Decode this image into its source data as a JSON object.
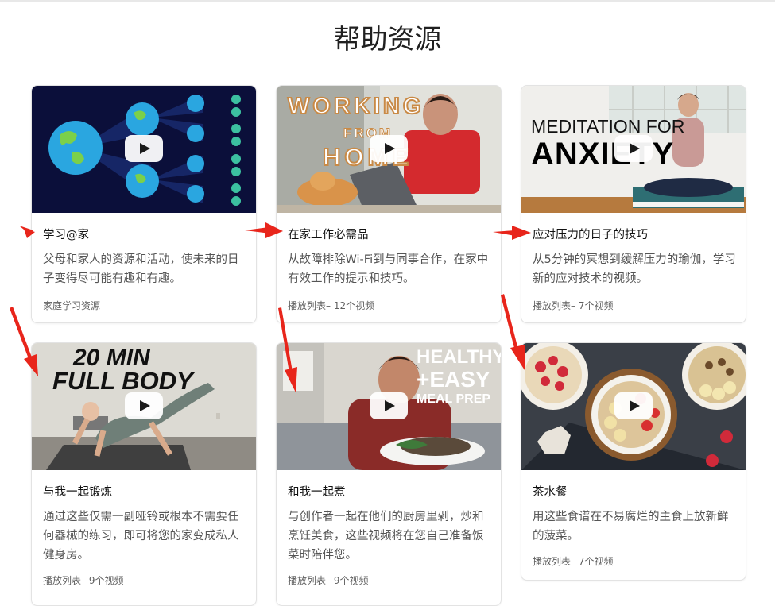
{
  "page": {
    "title": "帮助资源"
  },
  "cards": [
    {
      "title": "学习@家",
      "description": "父母和家人的资源和活动，使未来的日子变得尽可能有趣和有趣。",
      "meta": "家庭学习资源",
      "thumb_icon": "globe-network-thumbnail"
    },
    {
      "title": "在家工作必需品",
      "description": "从故障排除Wi-Fi到与同事合作，在家中有效工作的提示和技巧。",
      "meta": "播放列表– 12个视频",
      "thumb_icon": "working-from-home-thumbnail",
      "overlay": {
        "line1": "WORKING",
        "line2": "FROM",
        "line3": "HOME"
      }
    },
    {
      "title": "应对压力的日子的技巧",
      "description": "从5分钟的冥想到缓解压力的瑜伽，学习新的应对技术的视频。",
      "meta": "播放列表– 7个视频",
      "thumb_icon": "meditation-thumbnail",
      "overlay": {
        "line1": "MEDITATION FOR",
        "line2": "ANXIETY"
      }
    },
    {
      "title": "与我一起锻炼",
      "description": "通过这些仅需一副哑铃或根本不需要任何器械的练习，即可将您的家变成私人健身房。",
      "meta": "播放列表– 9个视频",
      "thumb_icon": "workout-thumbnail",
      "overlay": {
        "line1": "20 MIN",
        "line2": "FULL BODY"
      }
    },
    {
      "title": "和我一起煮",
      "description": "与创作者一起在他们的厨房里剁，炒和烹饪美食，这些视频将在您自己准备饭菜时陪伴您。",
      "meta": "播放列表– 9个视频",
      "thumb_icon": "cooking-thumbnail",
      "overlay": {
        "line1": "HEALTHY",
        "line2": "+EASY",
        "line3": "MEAL PREP"
      }
    },
    {
      "title": "茶水餐",
      "description": "用这些食谱在不易腐烂的主食上放新鲜的菠菜。",
      "meta": "播放列表– 7个视频",
      "thumb_icon": "oatmeal-bowls-thumbnail"
    }
  ],
  "colors": {
    "accent_arrow": "#e8251b",
    "card_border": "#e3e3e3",
    "meta_text": "#606060"
  }
}
